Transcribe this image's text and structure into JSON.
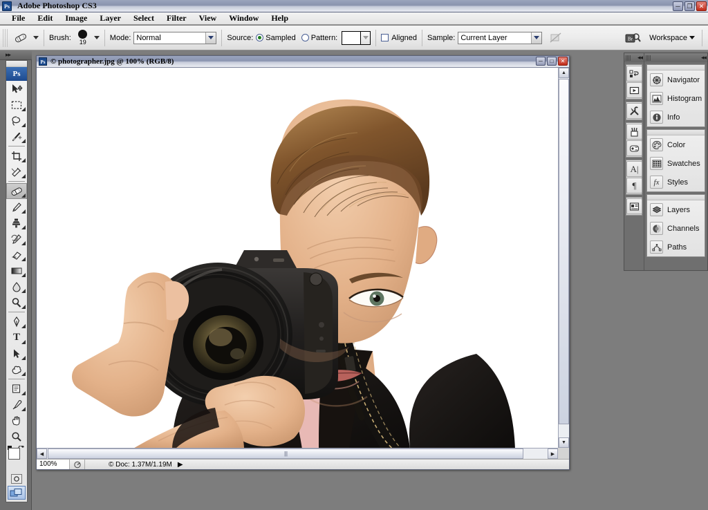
{
  "app": {
    "title": "Adobe Photoshop CS3",
    "logo_text": "Ps",
    "window_buttons": [
      {
        "name": "minimize",
        "glyph": "–"
      },
      {
        "name": "restore",
        "glyph": "❐"
      },
      {
        "name": "close",
        "glyph": "✕"
      }
    ]
  },
  "menubar": {
    "items": [
      "File",
      "Edit",
      "Image",
      "Layer",
      "Select",
      "Filter",
      "View",
      "Window",
      "Help"
    ]
  },
  "options_bar": {
    "tool_icon": "healing-brush-icon",
    "brush_label": "Brush:",
    "brush_size": "19",
    "mode_label": "Mode:",
    "mode_value": "Normal",
    "source_label": "Source:",
    "source_sampled": "Sampled",
    "source_pattern": "Pattern:",
    "source_selected": "Sampled",
    "aligned_label": "Aligned",
    "aligned_checked": false,
    "sample_label": "Sample:",
    "sample_value": "Current Layer",
    "ignore_adjustment_icon": "ignore-adjustment-layers-icon",
    "bridge_icon": "go-to-bridge-icon",
    "workspace_label": "Workspace"
  },
  "toolbox": {
    "logo_text": "Ps",
    "selected_tool": "healing-brush",
    "tools": [
      {
        "name": "move-tool",
        "glyph": "↖",
        "has_corner": false
      },
      {
        "name": "rectangular-marquee-tool",
        "glyph": "⬚",
        "has_corner": true
      },
      {
        "name": "lasso-tool",
        "glyph": "❀",
        "has_corner": true
      },
      {
        "name": "magic-wand-tool",
        "glyph": "✦",
        "has_corner": true
      },
      {
        "name": "crop-tool",
        "glyph": "⌗",
        "has_corner": true
      },
      {
        "name": "slice-tool",
        "glyph": "✂",
        "has_corner": true
      },
      {
        "name": "healing-brush-tool",
        "glyph": "✐",
        "has_corner": true
      },
      {
        "name": "brush-tool",
        "glyph": "✎",
        "has_corner": true
      },
      {
        "name": "clone-stamp-tool",
        "glyph": "⚑",
        "has_corner": true
      },
      {
        "name": "history-brush-tool",
        "glyph": "✒",
        "has_corner": true
      },
      {
        "name": "eraser-tool",
        "glyph": "▱",
        "has_corner": true
      },
      {
        "name": "gradient-tool",
        "glyph": "▤",
        "has_corner": true
      },
      {
        "name": "blur-tool",
        "glyph": "●",
        "has_corner": true
      },
      {
        "name": "dodge-tool",
        "glyph": "○",
        "has_corner": true
      },
      {
        "name": "pen-tool",
        "glyph": "✑",
        "has_corner": true
      },
      {
        "name": "type-tool",
        "glyph": "T",
        "has_corner": true
      },
      {
        "name": "path-selection-tool",
        "glyph": "➤",
        "has_corner": true
      },
      {
        "name": "custom-shape-tool",
        "glyph": "⬟",
        "has_corner": true
      },
      {
        "name": "notes-tool",
        "glyph": "▤",
        "has_corner": true
      },
      {
        "name": "eyedropper-tool",
        "glyph": "✒",
        "has_corner": true
      },
      {
        "name": "hand-tool",
        "glyph": "✋",
        "has_corner": false
      },
      {
        "name": "zoom-tool",
        "glyph": "⚲",
        "has_corner": false
      }
    ],
    "foreground_color": "#ffffff",
    "background_color": "#ffffff",
    "quick_mask_icon": "quick-mask-icon",
    "screen_mode_icon": "screen-mode-icon"
  },
  "document": {
    "title": "© photographer.jpg @ 100% (RGB/8)",
    "window_buttons": [
      {
        "name": "minimize",
        "glyph": "–"
      },
      {
        "name": "maximize",
        "glyph": "□"
      },
      {
        "name": "close",
        "glyph": "✕"
      }
    ],
    "zoom": "100%",
    "doc_info": "© Doc: 1.37M/1.19M",
    "image_alt": "photographer holding DSLR camera to his eye on white background"
  },
  "panel_dock": {
    "icon_buttons": [
      {
        "name": "tool-presets-icon",
        "glyph": "⎙"
      },
      {
        "name": "actions-icon",
        "glyph": "▶"
      },
      {
        "name": "tool-options-icon",
        "glyph": "⚒"
      },
      {
        "name": "brushes-icon",
        "glyph": "✒"
      },
      {
        "name": "clone-source-icon",
        "glyph": "⚙"
      },
      {
        "name": "character-icon",
        "glyph": "A"
      },
      {
        "name": "paragraph-icon",
        "glyph": "¶"
      },
      {
        "name": "layer-comps-icon",
        "glyph": "☰"
      }
    ],
    "groups": [
      {
        "name": "navigator-group",
        "panels": [
          {
            "label": "Navigator",
            "icon": "navigator-icon",
            "glyph": "✸"
          },
          {
            "label": "Histogram",
            "icon": "histogram-icon",
            "glyph": "▲"
          },
          {
            "label": "Info",
            "icon": "info-icon",
            "glyph": "i"
          }
        ]
      },
      {
        "name": "color-group",
        "panels": [
          {
            "label": "Color",
            "icon": "color-icon",
            "glyph": "◕"
          },
          {
            "label": "Swatches",
            "icon": "swatches-icon",
            "glyph": "▦"
          },
          {
            "label": "Styles",
            "icon": "styles-icon",
            "glyph": "fx"
          }
        ]
      },
      {
        "name": "layers-group",
        "panels": [
          {
            "label": "Layers",
            "icon": "layers-icon",
            "glyph": "◇"
          },
          {
            "label": "Channels",
            "icon": "channels-icon",
            "glyph": "◐"
          },
          {
            "label": "Paths",
            "icon": "paths-icon",
            "glyph": "⬡"
          }
        ]
      }
    ]
  },
  "colors": {
    "desktop": "#7d7d7d",
    "chrome": "#e8e8e8",
    "titlebar_start": "#9aa4bd",
    "accent_blue": "#1b4a8e",
    "close_red": "#c02a18"
  }
}
